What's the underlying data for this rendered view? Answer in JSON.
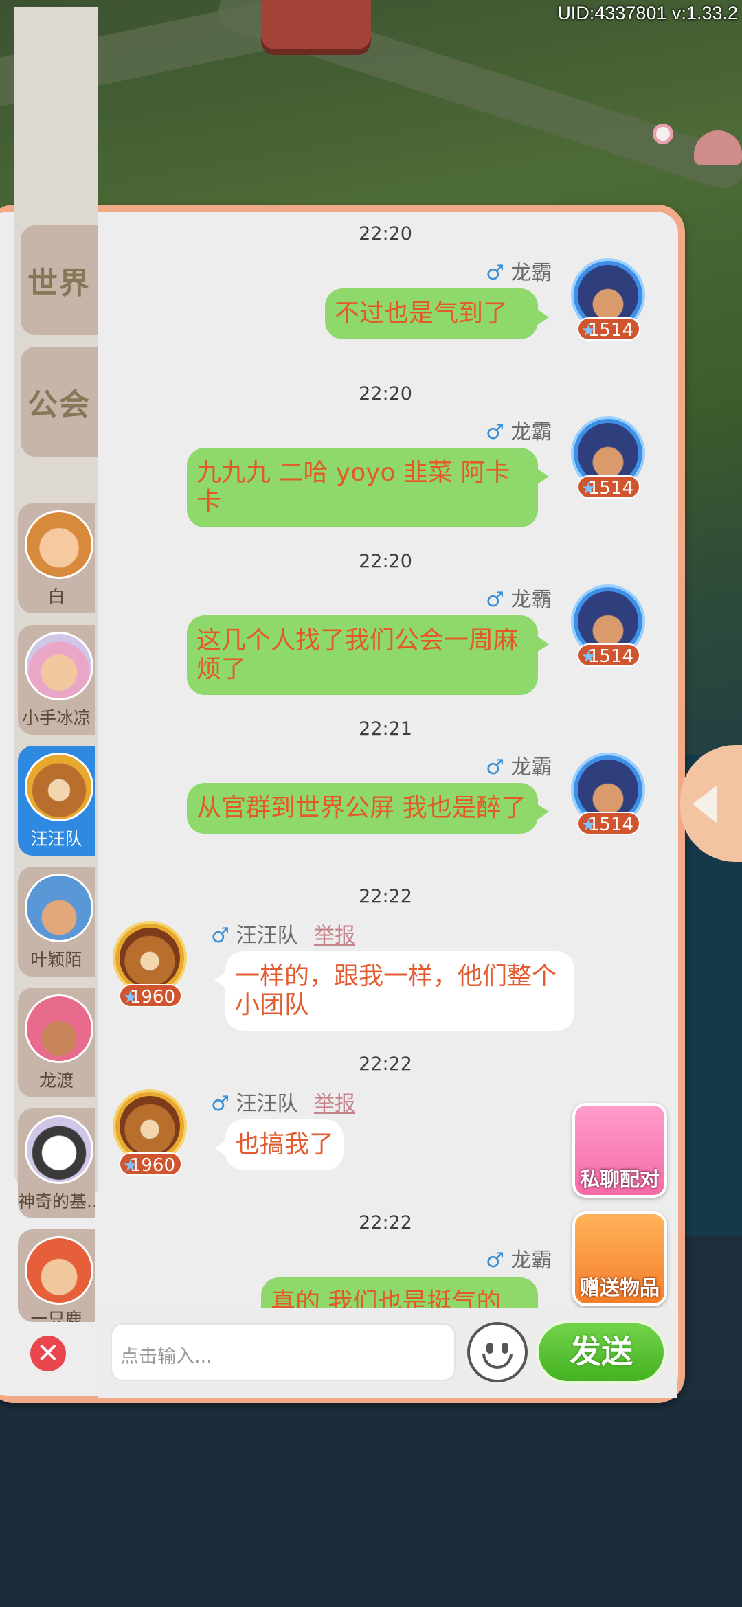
{
  "header": {
    "uid_version": "UID:4337801 v:1.33.2"
  },
  "channels": [
    {
      "label": "世界"
    },
    {
      "label": "公会"
    }
  ],
  "contacts": [
    {
      "name": "白"
    },
    {
      "name": "小手冰凉"
    },
    {
      "name": "汪汪队"
    },
    {
      "name": "叶颖陌"
    },
    {
      "name": "龙渡"
    },
    {
      "name": "神奇的基..."
    },
    {
      "name": "一只鹿"
    }
  ],
  "messages": [
    {
      "time": "22:20",
      "sender": "龙霸",
      "gender": "♂",
      "level": "1514",
      "text": "不过也是气到了"
    },
    {
      "time": "22:20",
      "sender": "龙霸",
      "gender": "♂",
      "level": "1514",
      "text": "九九九 二哈 yoyo 韭菜 阿卡卡"
    },
    {
      "time": "22:20",
      "sender": "龙霸",
      "gender": "♂",
      "level": "1514",
      "text": "这几个人找了我们公会一周麻烦了"
    },
    {
      "time": "22:21",
      "sender": "龙霸",
      "gender": "♂",
      "level": "1514",
      "text": "从官群到世界公屏 我也是醉了"
    },
    {
      "time": "22:22",
      "sender": "汪汪队",
      "gender": "♂",
      "level": "1960",
      "report": "举报",
      "text": "一样的，跟我一样，他们整个小团队"
    },
    {
      "time": "22:22",
      "sender": "汪汪队",
      "gender": "♂",
      "level": "1960",
      "report": "举报",
      "text": "也搞我了"
    },
    {
      "time": "22:22",
      "sender": "龙霸",
      "gender": "♂",
      "level": "",
      "text": "真的 我们也是挺气的"
    }
  ],
  "actions": {
    "private_match": "私聊配对",
    "gift": "赠送物品"
  },
  "input": {
    "placeholder": "点击输入...",
    "send_label": "发送"
  },
  "colors": {
    "my_bubble": "#8fd86b",
    "text_orange": "#e35b2f",
    "send_green": "#44b221",
    "panel_border": "#f1a987"
  }
}
